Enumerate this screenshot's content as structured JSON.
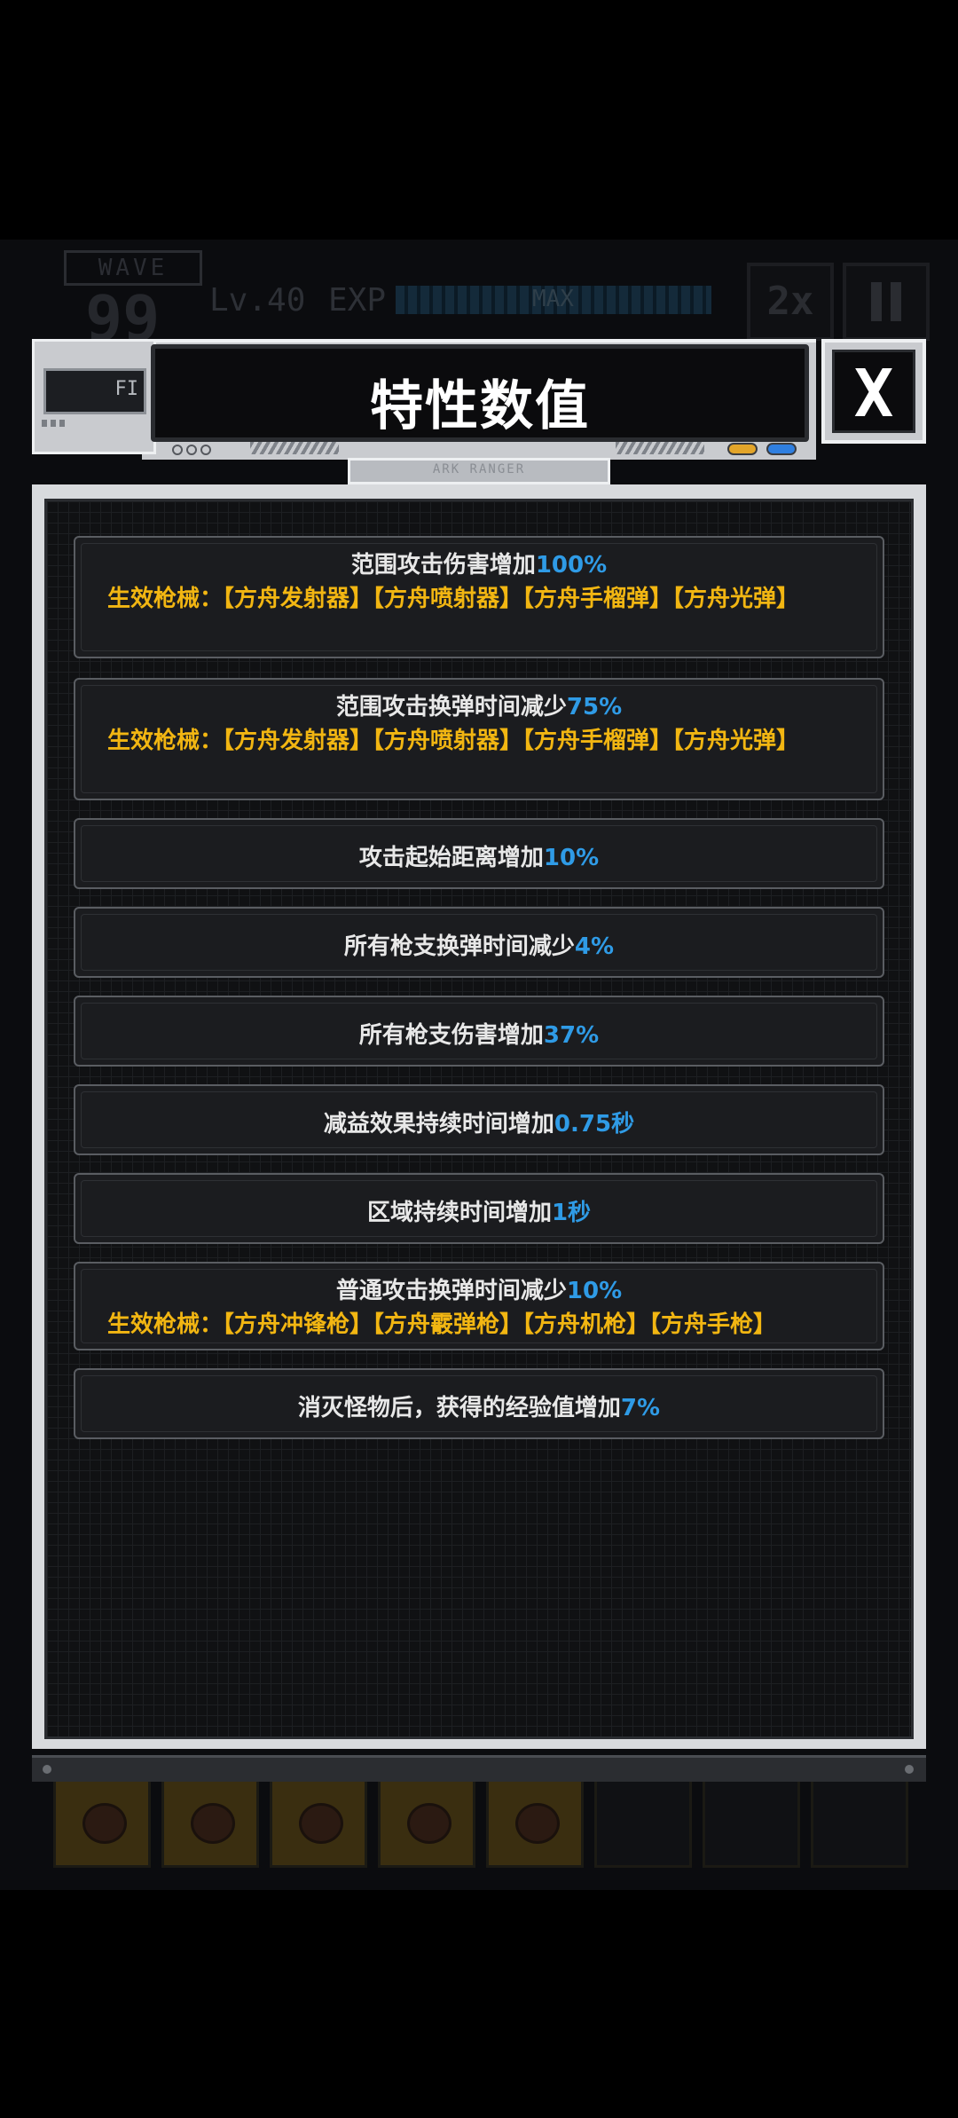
{
  "hud": {
    "wave_label": "WAVE",
    "wave_number": "99",
    "level": "Lv.40",
    "exp_label": "EXP",
    "exp_status": "MAX",
    "speed_label": "2x"
  },
  "dialog": {
    "title": "特性数值",
    "close_label": "X",
    "header_screen_text": "FI",
    "header_tab_text": "ARK RANGER"
  },
  "weapons_prefix": "生效枪械：",
  "stats": [
    {
      "text": "范围攻击伤害增加",
      "value": "100%",
      "weapons": "【方舟发射器】【方舟喷射器】【方舟手榴弹】【方舟光弹】"
    },
    {
      "text": "范围攻击换弹时间减少",
      "value": "75%",
      "weapons": "【方舟发射器】【方舟喷射器】【方舟手榴弹】【方舟光弹】"
    },
    {
      "text": "攻击起始距离增加",
      "value": "10%"
    },
    {
      "text": "所有枪支换弹时间减少",
      "value": "4%"
    },
    {
      "text": "所有枪支伤害增加",
      "value": "37%"
    },
    {
      "text": "减益效果持续时间增加",
      "value": "0.75秒"
    },
    {
      "text": "区域持续时间增加",
      "value": "1秒"
    },
    {
      "text": "普通攻击换弹时间减少",
      "value": "10%",
      "weapons": "【方舟冲锋枪】【方舟霰弹枪】【方舟机枪】【方舟手枪】"
    },
    {
      "text": "消灭怪物后，获得的经验值增加",
      "value": "7%"
    }
  ],
  "colors": {
    "value_blue": "#2f9be6",
    "weapon_gold": "#f2b612",
    "text_white": "#e8e8e8"
  }
}
